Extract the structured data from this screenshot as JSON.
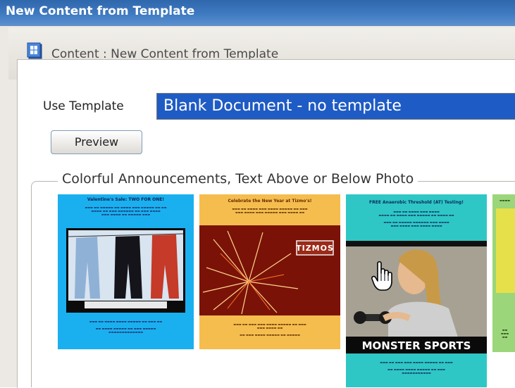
{
  "window": {
    "title": "New Content from Template"
  },
  "header": {
    "breadcrumb": "Content : New Content from Template",
    "icon": "content-icon"
  },
  "form": {
    "use_template_label": "Use Template",
    "selected_template": "Blank Document - no template",
    "preview_label": "Preview"
  },
  "group": {
    "legend": "Colorful Announcements, Text Above or Below Photo"
  },
  "templates": [
    {
      "heading": "Valentine's Sale: TWO FOR ONE!",
      "footer": "",
      "bg": "#1ab0f0"
    },
    {
      "heading": "Celebrate the New Year at Tizmo's!",
      "badge": "TIZMOS",
      "bg": "#f5bd4e"
    },
    {
      "heading": "FREE Anaerobic Threshold (AT) Testing!",
      "banner": "MONSTER SPORTS",
      "bg": "#2ec7c6"
    },
    {
      "heading": "",
      "bg": "#9bd67a"
    }
  ],
  "colors": {
    "selection": "#1f5bc4",
    "titlebar": "#3a72b8"
  }
}
